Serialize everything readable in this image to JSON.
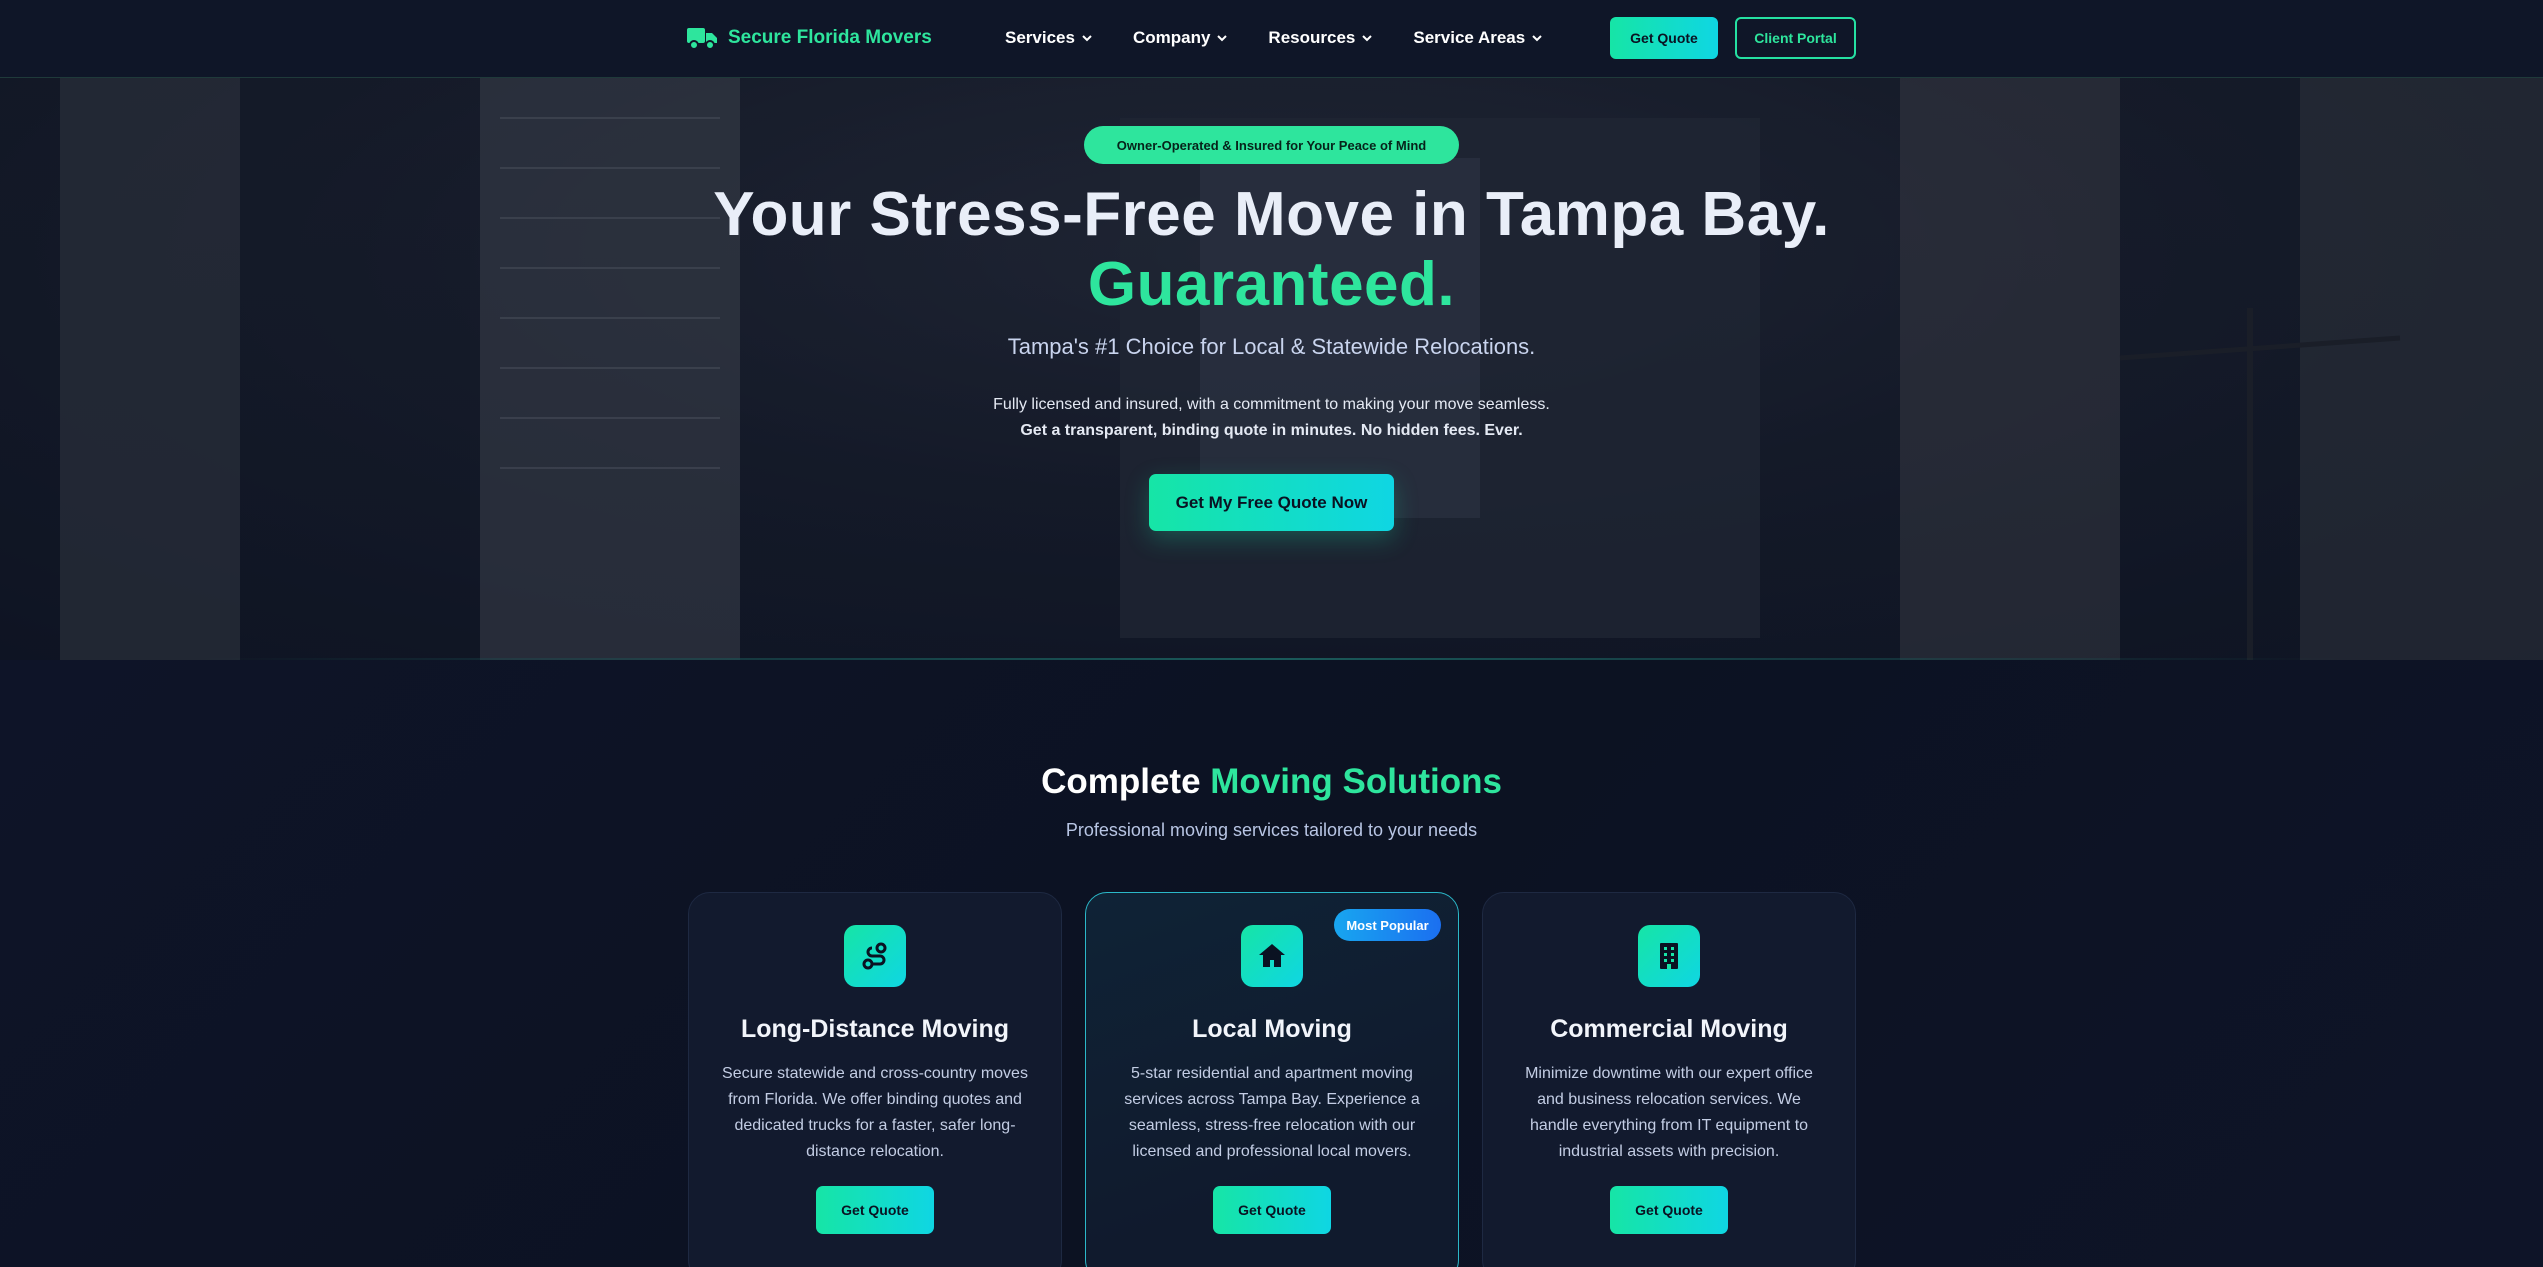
{
  "navbar": {
    "brand": "Secure Florida Movers",
    "brand_icon": "truck-icon",
    "links": [
      "Services",
      "Company",
      "Resources",
      "Service Areas"
    ],
    "quote_button": "Get Quote",
    "portal_button": "Client Portal"
  },
  "hero": {
    "badge": "Owner-Operated & Insured for Your Peace of Mind",
    "title": "Your Stress-Free Move in Tampa Bay.",
    "title_accent": "Guaranteed.",
    "subtitle": "Tampa's #1 Choice for Local & Statewide Relocations.",
    "description": "Fully licensed and insured, with a commitment to making your move seamless.",
    "description_strong": "Get a transparent, binding quote in minutes. No hidden fees. Ever.",
    "cta": "Get My Free Quote Now"
  },
  "services": {
    "title": "Complete",
    "title_accent": "Moving Solutions",
    "subtitle": "Professional moving services tailored to your needs",
    "cards": [
      {
        "icon": "route-icon",
        "title": "Long-Distance Moving",
        "description": "Secure statewide and cross-country moves from Florida. We offer binding quotes and dedicated trucks for a faster, safer long-distance relocation.",
        "button": "Get Quote"
      },
      {
        "icon": "home-icon",
        "title": "Local Moving",
        "badge": "Most Popular",
        "description": "5-star residential and apartment moving services across Tampa Bay. Experience a seamless, stress-free relocation with our licensed and professional local movers.",
        "button": "Get Quote"
      },
      {
        "icon": "building-icon",
        "title": "Commercial Moving",
        "description": "Minimize downtime with our expert office and business relocation services. We handle everything from IT equipment to industrial assets with precision.",
        "button": "Get Quote"
      }
    ]
  },
  "colors": {
    "accent": "#2ee59d",
    "background": "#0d1326",
    "gradient_start": "#16e5a6",
    "gradient_end": "#0fd6e3",
    "badge_blue": "#1b6ff0"
  }
}
